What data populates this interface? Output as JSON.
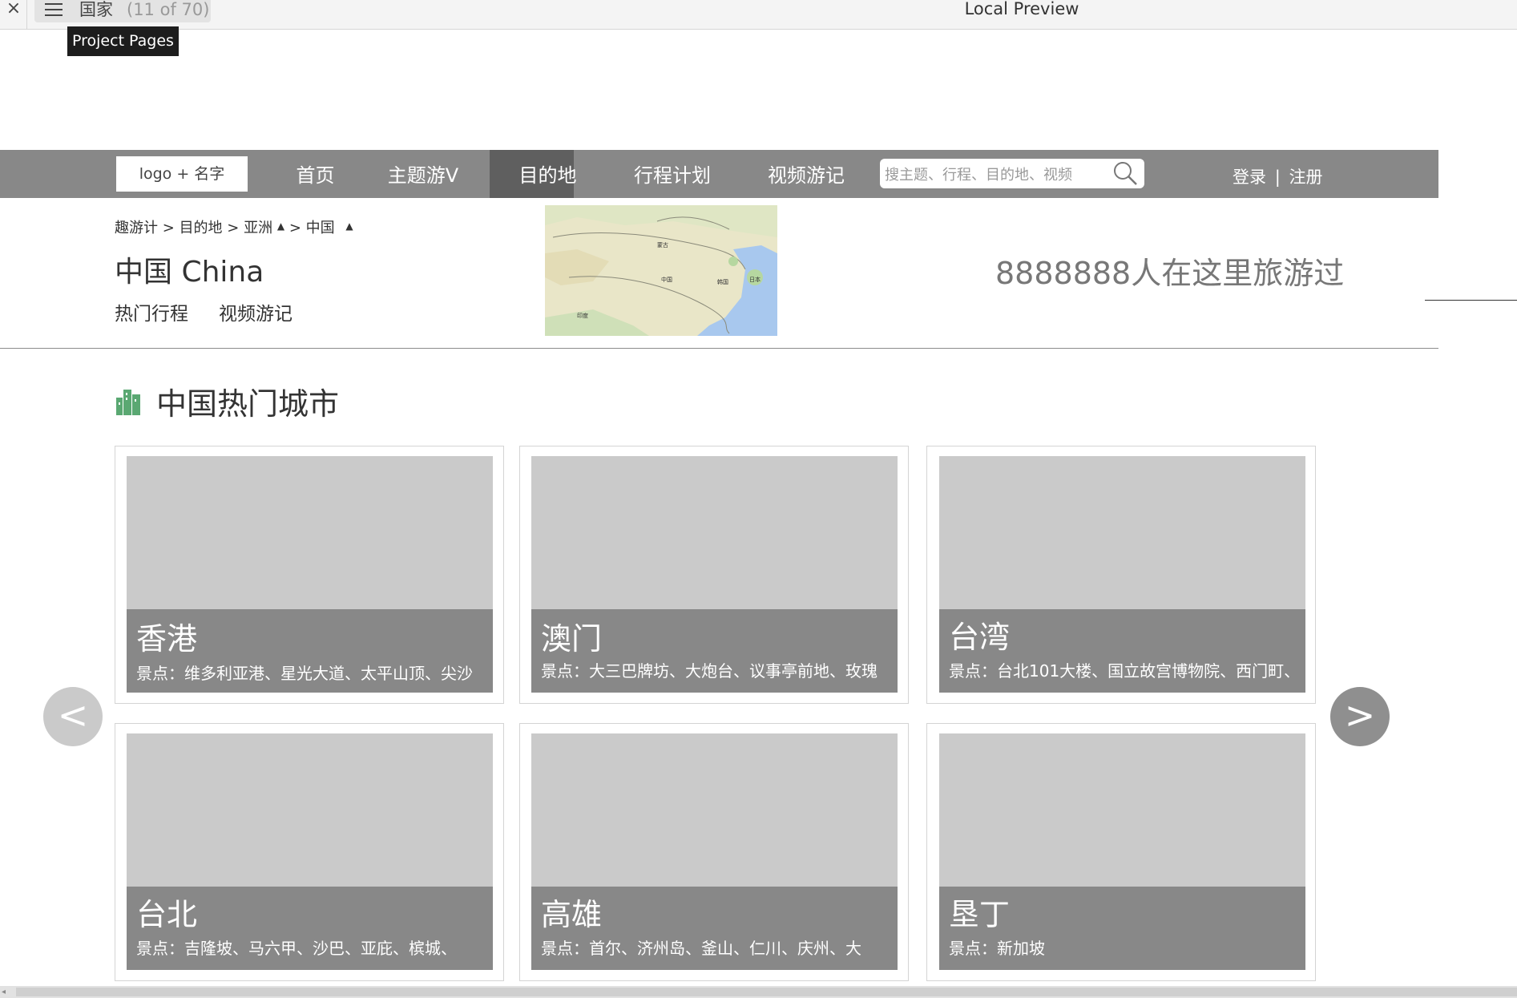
{
  "preview": {
    "close_glyph": "×",
    "page_name": "国家",
    "page_count": "(11 of 70)",
    "title": "Local Preview",
    "tooltip": "Project Pages"
  },
  "nav": {
    "logo": "logo + 名字",
    "items": [
      "首页",
      "主题游V",
      "目的地",
      "行程计划",
      "视频游记"
    ],
    "active_index": 2,
    "search_placeholder": "搜主题、行程、目的地、视频",
    "login": "登录",
    "auth_separator": "|",
    "register": "注册"
  },
  "breadcrumb": {
    "items": [
      "趣游计",
      "目的地",
      "亚洲",
      "中国"
    ],
    "sep": ">",
    "caret": "▲"
  },
  "header": {
    "country_title": "中国 China",
    "links": [
      "热门行程",
      "视频游记"
    ],
    "visitors": "8888888人在这里旅游过"
  },
  "map_labels": [
    "蒙古",
    "中国",
    "印度",
    "日本",
    "韩国"
  ],
  "section": {
    "title": "中国热门城市"
  },
  "cities": [
    {
      "name": "香港",
      "sights": "景点：维多利亚港、星光大道、太平山顶、尖沙"
    },
    {
      "name": "澳门",
      "sights": "景点：大三巴牌坊、大炮台、议事亭前地、玫瑰"
    },
    {
      "name": "台湾",
      "sights": "景点：台北101大楼、国立故宫博物院、西门町、"
    },
    {
      "name": "台北",
      "sights": "景点：吉隆坡、马六甲、沙巴、亚庇、槟城、"
    },
    {
      "name": "高雄",
      "sights": "景点：首尔、济州岛、釜山、仁川、庆州、大"
    },
    {
      "name": "垦丁",
      "sights": "景点：新加坡"
    }
  ],
  "arrows": {
    "prev": "<",
    "next": ">"
  },
  "colors": {
    "navbar": "#888888",
    "nav_active": "#5f5f5f",
    "card_image": "#cacaca",
    "card_band": "#888888",
    "section_icon": "#5aa872"
  }
}
